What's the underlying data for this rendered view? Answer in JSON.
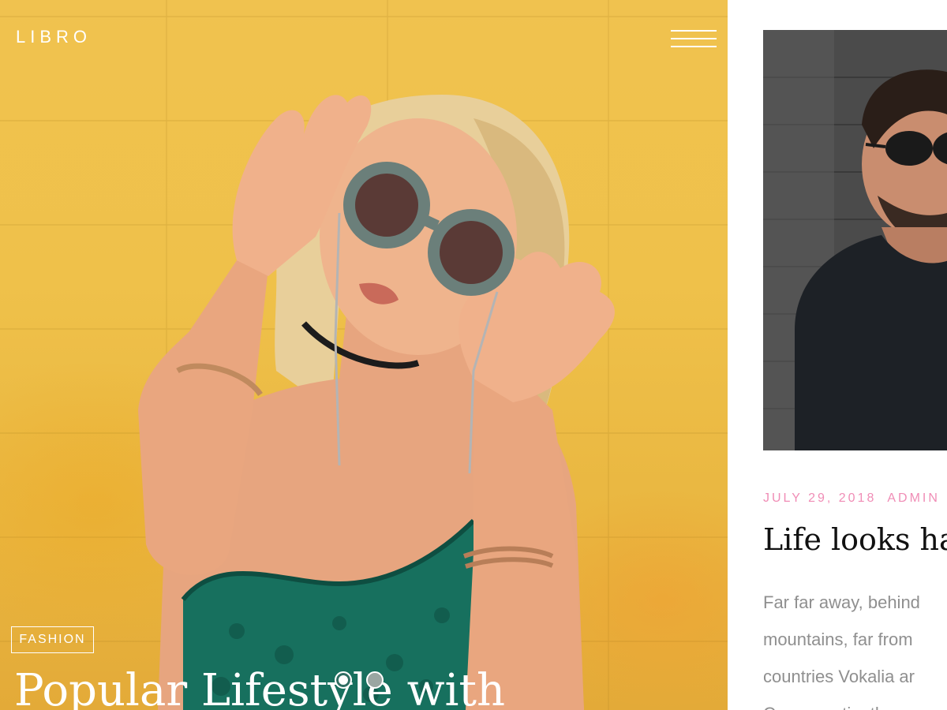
{
  "brand": {
    "logo": "LIBRO"
  },
  "header": {
    "menu_icon": "hamburger-menu-icon"
  },
  "hero": {
    "category": "FASHION",
    "title": "Popular Lifestyle with",
    "slider": {
      "count": 2,
      "active_index": 0
    }
  },
  "post": {
    "date": "JULY 29, 2018",
    "author": "ADMIN",
    "title": "Life looks hap",
    "excerpt_lines": [
      "Far far away, behind",
      "mountains, far from",
      "countries Vokalia ar",
      "Consonantia, there"
    ]
  },
  "colors": {
    "accent_pink": "#f08db6",
    "hero_yellow": "#f0c24f",
    "text_dark": "#111111",
    "text_muted": "#8f8f8f"
  }
}
